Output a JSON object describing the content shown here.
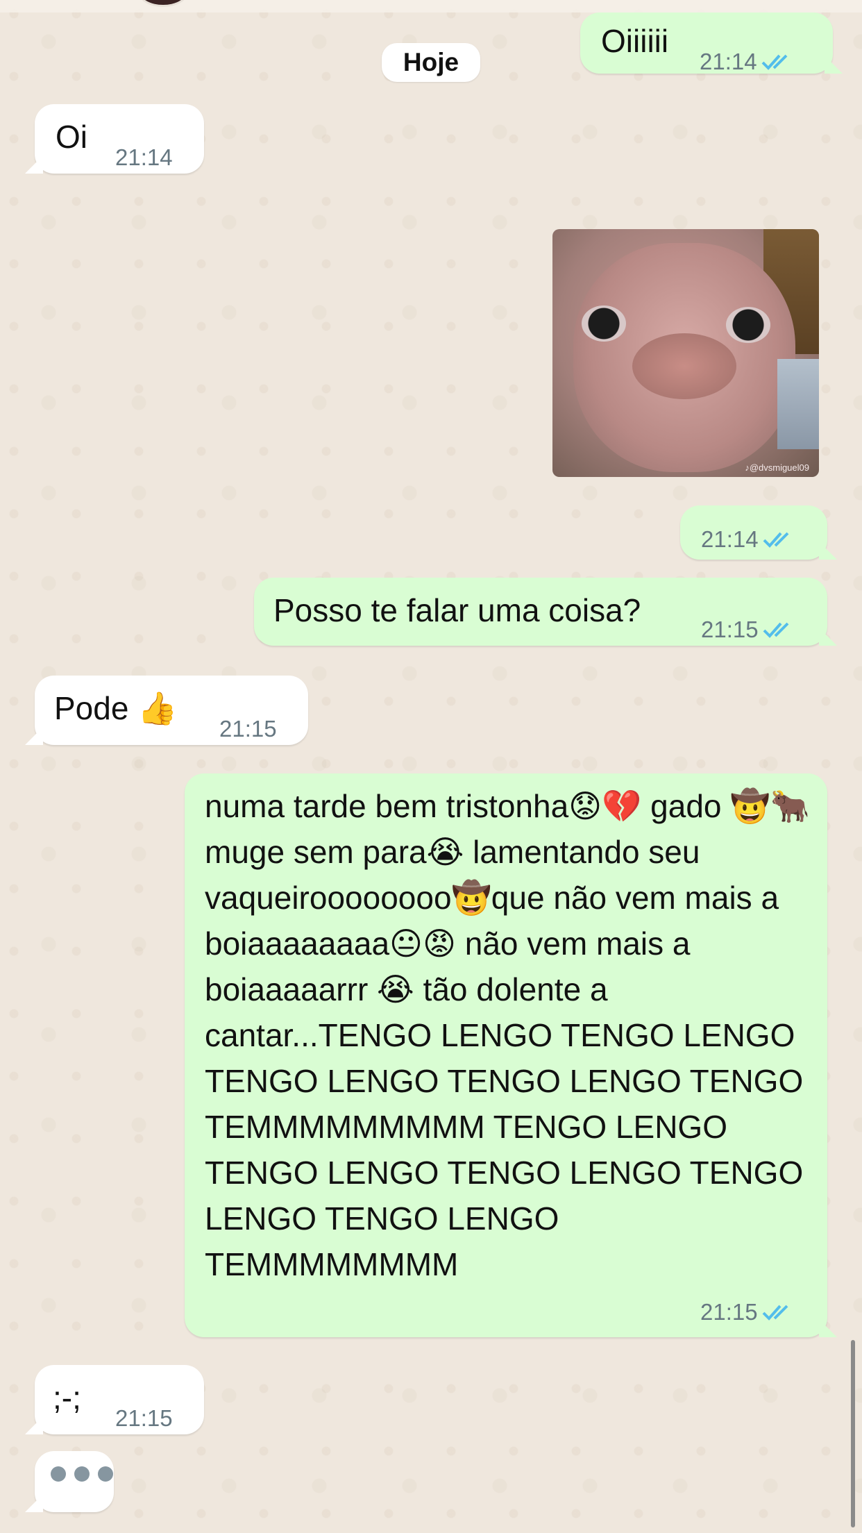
{
  "chat": {
    "date_separator": "Hoje",
    "messages": [
      {
        "id": "m1",
        "direction": "out",
        "text": "Oiiiiii",
        "time": "21:14",
        "status": "read"
      },
      {
        "id": "m2",
        "direction": "in",
        "text": "Oi",
        "time": "21:14"
      },
      {
        "id": "m3",
        "direction": "out",
        "type": "image",
        "watermark": "♪@dvsmiguel09",
        "time": "21:14",
        "status": "read"
      },
      {
        "id": "m4",
        "direction": "out",
        "text": "Posso te falar uma coisa?",
        "time": "21:15",
        "status": "read"
      },
      {
        "id": "m5",
        "direction": "in",
        "text": "Pode 👍",
        "time": "21:15"
      },
      {
        "id": "m6",
        "direction": "out",
        "text": "numa tarde bem tristonha😟💔 gado 🤠🐂muge sem para😭 lamentando seu vaqueiroooooooo🤠que não vem mais a boiaaaaaaaa😐😡 não vem mais a boiaaaaarrr 😭 tão dolente a cantar...TENGO LENGO TENGO LENGO TENGO LENGO TENGO LENGO TENGO TEMMMMMMMMM TENGO LENGO TENGO LENGO TENGO LENGO TENGO LENGO TENGO LENGO TEMMMMMMMM",
        "time": "21:15",
        "status": "read"
      },
      {
        "id": "m7",
        "direction": "in",
        "text": ";-;",
        "time": "21:15"
      }
    ],
    "typing_indicator": "•••"
  },
  "colors": {
    "incoming_bubble": "#ffffff",
    "outgoing_bubble": "#d9fdd3",
    "read_ticks": "#53bdeb",
    "timestamp": "#667781",
    "wallpaper": "#efe7dd"
  },
  "icons": {
    "read_status": "double-check-icon",
    "typing": "typing-dots-icon"
  }
}
